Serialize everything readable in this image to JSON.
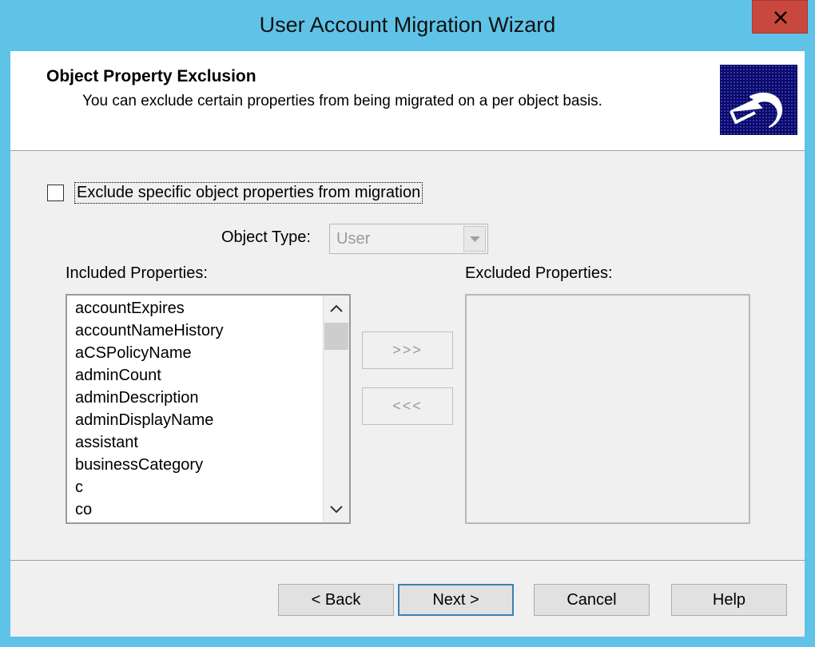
{
  "window": {
    "title": "User Account Migration Wizard",
    "close_glyph": "✕"
  },
  "header": {
    "title": "Object Property Exclusion",
    "subtitle": "You can exclude certain properties from being migrated on a per object basis.",
    "logo_icon": "migration-arrow-icon"
  },
  "options": {
    "exclude_checkbox_label": "Exclude specific object properties from migration",
    "exclude_checked": false,
    "object_type_label": "Object Type:",
    "object_type_value": "User"
  },
  "included": {
    "label": "Included Properties:",
    "items": [
      "accountExpires",
      "accountNameHistory",
      "aCSPolicyName",
      "adminCount",
      "adminDescription",
      "adminDisplayName",
      "assistant",
      "businessCategory",
      "c",
      "co"
    ]
  },
  "excluded": {
    "label": "Excluded Properties:",
    "items": []
  },
  "move_buttons": {
    "add": ">>>",
    "remove": "<<<"
  },
  "footer": {
    "back": "< Back",
    "next": "Next >",
    "cancel": "Cancel",
    "help": "Help"
  },
  "colors": {
    "titlebar": "#5fc3e8",
    "close_button": "#c9483d",
    "dialog_background": "#f0f0f0",
    "default_button_border": "#3c7fb1"
  }
}
